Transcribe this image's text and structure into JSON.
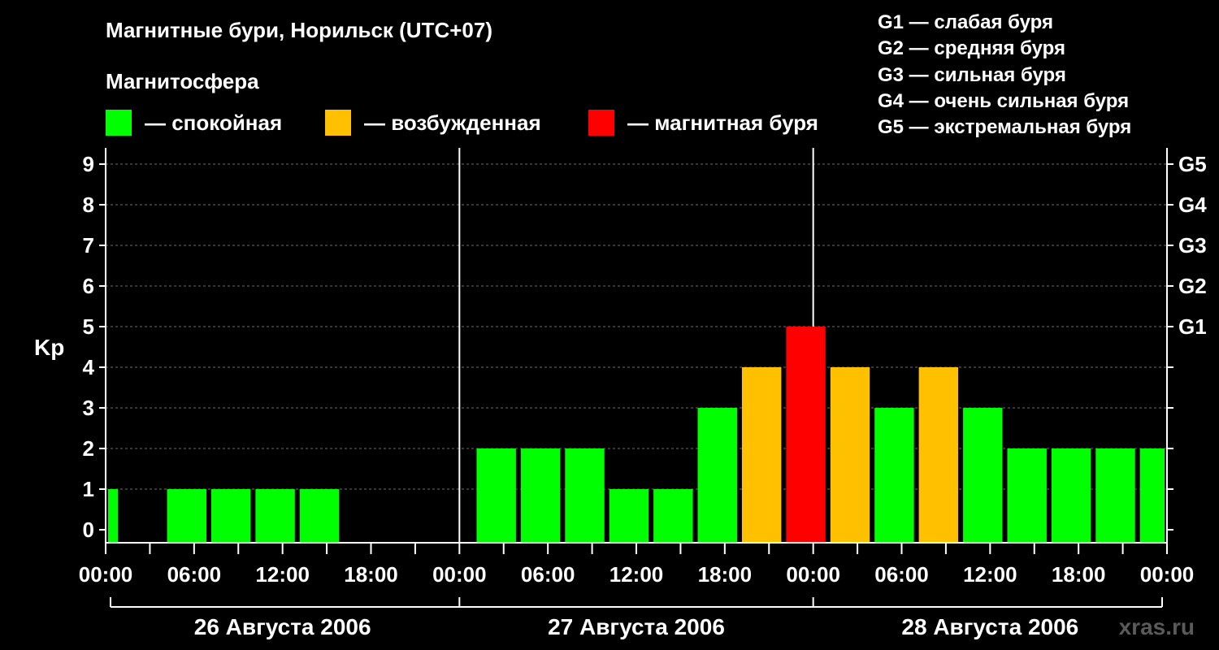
{
  "chart_data": {
    "type": "bar",
    "title": "Магнитные бури, Норильск (UTC+07)",
    "subtitle": "Магнитосфера",
    "ylabel": "Kp",
    "ylim": [
      0,
      9
    ],
    "yticks": [
      0,
      1,
      2,
      3,
      4,
      5,
      6,
      7,
      8,
      9
    ],
    "right_ticks": [
      {
        "label": "G1",
        "value": 5
      },
      {
        "label": "G2",
        "value": 6
      },
      {
        "label": "G3",
        "value": 7
      },
      {
        "label": "G4",
        "value": 8
      },
      {
        "label": "G5",
        "value": 9
      }
    ],
    "grid": true,
    "legend": [
      {
        "label": "— спокойная",
        "color": "#00ff00"
      },
      {
        "label": "— возбужденная",
        "color": "#ffc000"
      },
      {
        "label": "— магнитная буря",
        "color": "#ff0000"
      }
    ],
    "storm_levels": [
      "G1 — слабая буря",
      "G2 — средняя буря",
      "G3 — сильная буря",
      "G4 — очень сильная буря",
      "G5 — экстремальная буря"
    ],
    "xlim": [
      0,
      72
    ],
    "x_unit": "hours since 26 Августа 2006 00:00",
    "xticks": [
      {
        "label": "00:00",
        "hour": 0
      },
      {
        "label": "06:00",
        "hour": 6
      },
      {
        "label": "12:00",
        "hour": 12
      },
      {
        "label": "18:00",
        "hour": 18
      },
      {
        "label": "00:00",
        "hour": 24
      },
      {
        "label": "06:00",
        "hour": 30
      },
      {
        "label": "12:00",
        "hour": 36
      },
      {
        "label": "18:00",
        "hour": 42
      },
      {
        "label": "00:00",
        "hour": 48
      },
      {
        "label": "06:00",
        "hour": 54
      },
      {
        "label": "12:00",
        "hour": 60
      },
      {
        "label": "18:00",
        "hour": 66
      },
      {
        "label": "00:00",
        "hour": 72
      }
    ],
    "days": [
      {
        "label": "26 Августа 2006",
        "start": 0,
        "end": 24
      },
      {
        "label": "27 Августа 2006",
        "start": 24,
        "end": 48
      },
      {
        "label": "28 Августа 2006",
        "start": 48,
        "end": 72
      }
    ],
    "colors": {
      "calm": "#00ff00",
      "excited": "#ffc000",
      "storm": "#ff0000"
    },
    "bars": [
      {
        "start": 0,
        "end": 1,
        "kp": 1,
        "state": "calm"
      },
      {
        "start": 4,
        "end": 7,
        "kp": 1,
        "state": "calm"
      },
      {
        "start": 7,
        "end": 10,
        "kp": 1,
        "state": "calm"
      },
      {
        "start": 10,
        "end": 13,
        "kp": 1,
        "state": "calm"
      },
      {
        "start": 13,
        "end": 16,
        "kp": 1,
        "state": "calm"
      },
      {
        "start": 25,
        "end": 28,
        "kp": 2,
        "state": "calm"
      },
      {
        "start": 28,
        "end": 31,
        "kp": 2,
        "state": "calm"
      },
      {
        "start": 31,
        "end": 34,
        "kp": 2,
        "state": "calm"
      },
      {
        "start": 34,
        "end": 37,
        "kp": 1,
        "state": "calm"
      },
      {
        "start": 37,
        "end": 40,
        "kp": 1,
        "state": "calm"
      },
      {
        "start": 40,
        "end": 43,
        "kp": 3,
        "state": "calm"
      },
      {
        "start": 43,
        "end": 46,
        "kp": 4,
        "state": "excited"
      },
      {
        "start": 46,
        "end": 49,
        "kp": 5,
        "state": "storm"
      },
      {
        "start": 49,
        "end": 52,
        "kp": 4,
        "state": "excited"
      },
      {
        "start": 52,
        "end": 55,
        "kp": 3,
        "state": "calm"
      },
      {
        "start": 55,
        "end": 58,
        "kp": 4,
        "state": "excited"
      },
      {
        "start": 58,
        "end": 61,
        "kp": 3,
        "state": "calm"
      },
      {
        "start": 61,
        "end": 64,
        "kp": 2,
        "state": "calm"
      },
      {
        "start": 64,
        "end": 67,
        "kp": 2,
        "state": "calm"
      },
      {
        "start": 67,
        "end": 70,
        "kp": 2,
        "state": "calm"
      },
      {
        "start": 70,
        "end": 72,
        "kp": 2,
        "state": "calm"
      }
    ]
  },
  "watermark": "xras.ru"
}
